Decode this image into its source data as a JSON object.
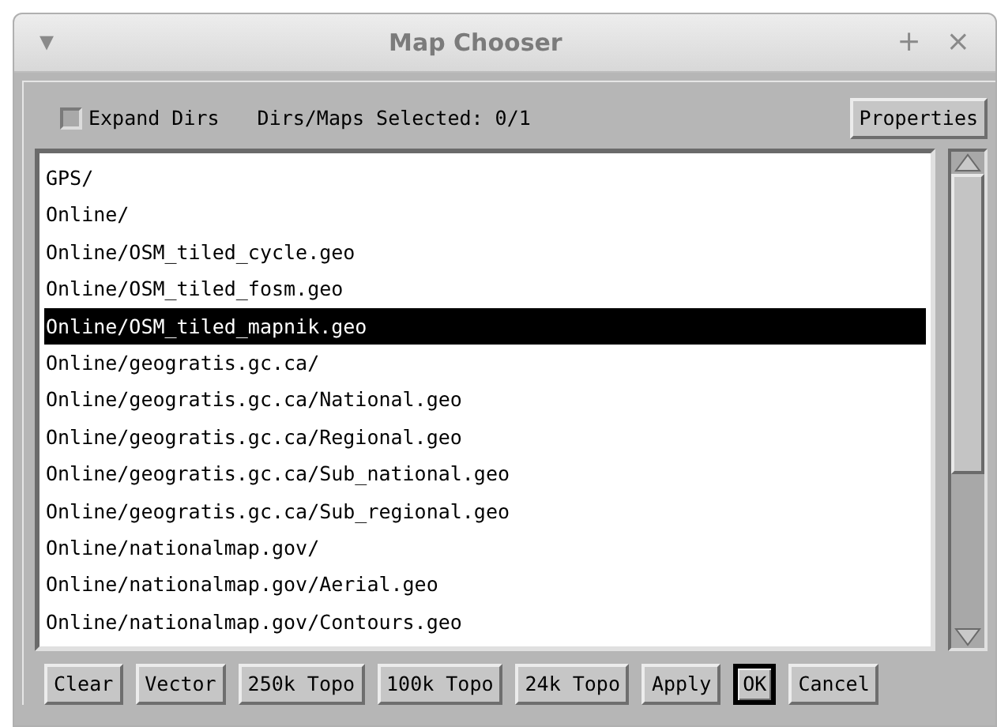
{
  "window": {
    "title": "Map Chooser",
    "menu_glyph": "▾",
    "maximize_glyph": "+",
    "close_glyph": "×"
  },
  "toolbar": {
    "expand_dirs": {
      "label": "Expand Dirs",
      "checked": false
    },
    "selection_count": "Dirs/Maps Selected: 0/1",
    "properties_button": "Properties"
  },
  "map_list": [
    {
      "label": "GPS/",
      "selected": false
    },
    {
      "label": "Online/",
      "selected": false
    },
    {
      "label": "Online/OSM_tiled_cycle.geo",
      "selected": false
    },
    {
      "label": "Online/OSM_tiled_fosm.geo",
      "selected": false
    },
    {
      "label": "Online/OSM_tiled_mapnik.geo",
      "selected": true
    },
    {
      "label": "Online/geogratis.gc.ca/",
      "selected": false
    },
    {
      "label": "Online/geogratis.gc.ca/National.geo",
      "selected": false
    },
    {
      "label": "Online/geogratis.gc.ca/Regional.geo",
      "selected": false
    },
    {
      "label": "Online/geogratis.gc.ca/Sub_national.geo",
      "selected": false
    },
    {
      "label": "Online/geogratis.gc.ca/Sub_regional.geo",
      "selected": false
    },
    {
      "label": "Online/nationalmap.gov/",
      "selected": false
    },
    {
      "label": "Online/nationalmap.gov/Aerial.geo",
      "selected": false
    },
    {
      "label": "Online/nationalmap.gov/Contours.geo",
      "selected": false
    }
  ],
  "buttons": [
    {
      "label": "Clear",
      "default": false
    },
    {
      "label": "Vector",
      "default": false
    },
    {
      "label": "250k Topo",
      "default": false
    },
    {
      "label": "100k Topo",
      "default": false
    },
    {
      "label": "24k Topo",
      "default": false
    },
    {
      "label": "Apply",
      "default": false
    },
    {
      "label": "OK",
      "default": true
    },
    {
      "label": "Cancel",
      "default": false
    }
  ]
}
